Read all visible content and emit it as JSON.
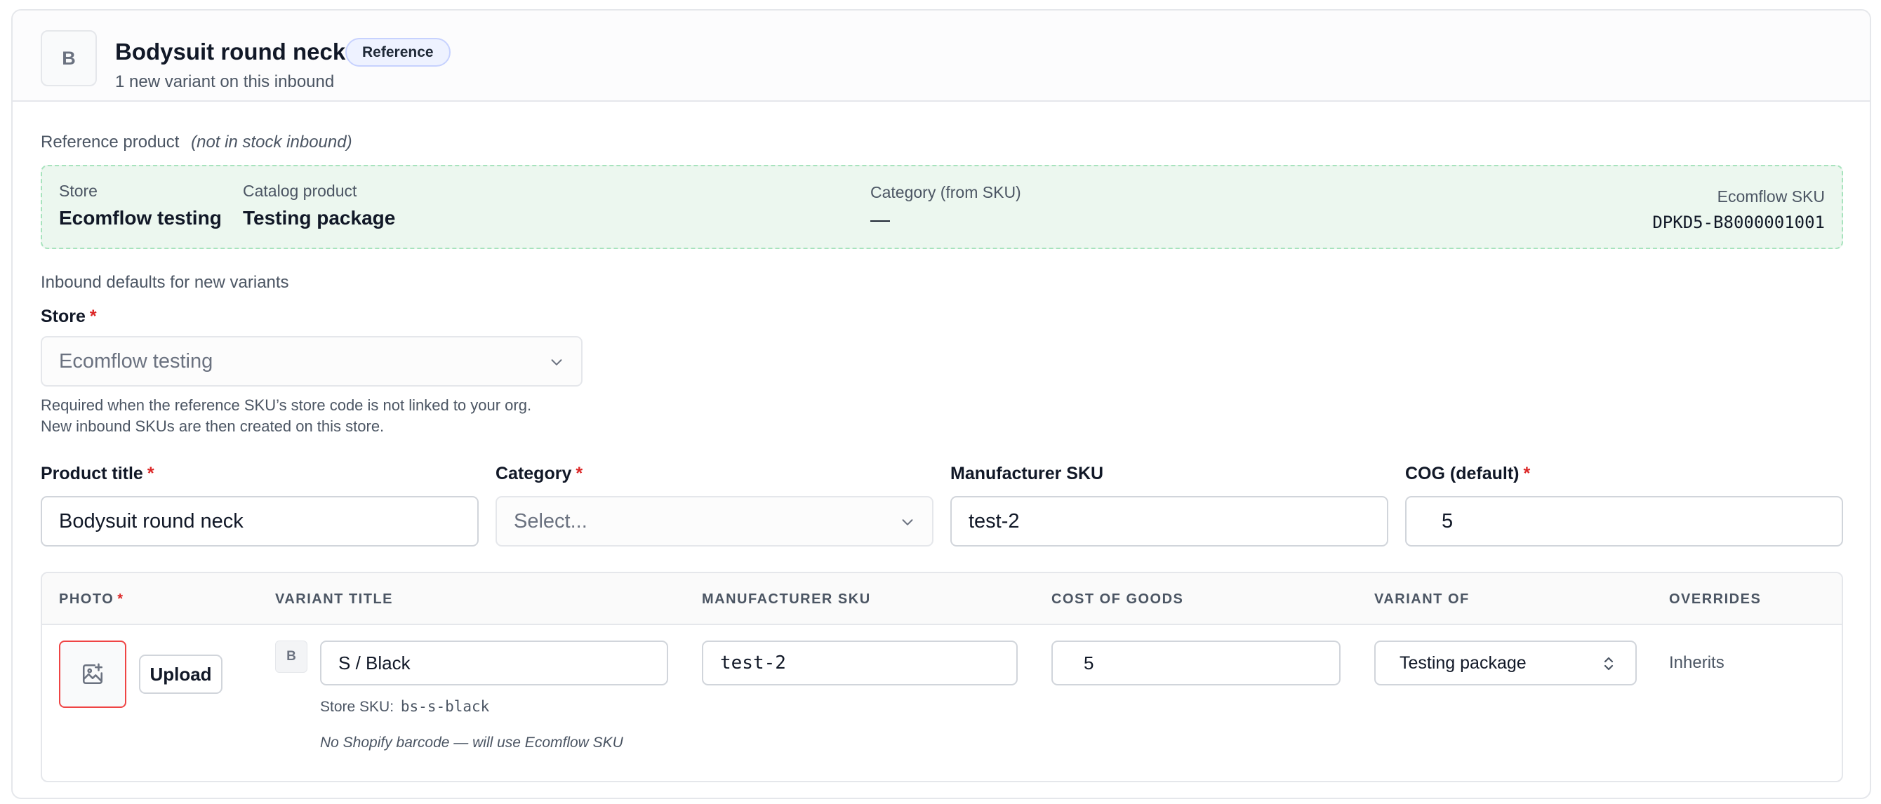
{
  "header": {
    "avatar_letter": "B",
    "product_name": "Bodysuit round neck",
    "badge": "Reference",
    "subtitle": "1 new variant on this inbound"
  },
  "reference": {
    "label": "Reference product",
    "note": "(not in stock inbound)",
    "store_key": "Store",
    "store_value": "Ecomflow testing",
    "catalog_key": "Catalog product",
    "catalog_value": "Testing package",
    "category_key": "Category (from SKU)",
    "category_value": "—",
    "sku_key": "Ecomflow SKU",
    "sku_value": "DPKD5-B8000001001"
  },
  "defaults": {
    "section_label": "Inbound defaults for new variants",
    "store_label": "Store",
    "required_mark": "*",
    "store_value": "Ecomflow testing",
    "help_line_1": "Required when the reference SKU’s store code is not linked to your org.",
    "help_line_2": "New inbound SKUs are then created on this store."
  },
  "fields": {
    "product_title_label": "Product title",
    "product_title_value": "Bodysuit round neck",
    "category_label": "Category",
    "category_placeholder": "Select...",
    "manufacturer_sku_label": "Manufacturer SKU",
    "manufacturer_sku_value": "test-2",
    "cog_label": "COG (default)",
    "cog_value": "5"
  },
  "table": {
    "headers": {
      "photo": "PHOTO",
      "variant_title": "VARIANT TITLE",
      "manufacturer_sku": "MANUFACTURER SKU",
      "cost_of_goods": "COST OF GOODS",
      "variant_of": "VARIANT OF",
      "overrides": "OVERRIDES"
    },
    "rows": [
      {
        "upload_label": "Upload",
        "avatar_letter": "B",
        "variant_title": "S / Black",
        "store_sku_label": "Store SKU:",
        "store_sku_value": "bs-s-black",
        "barcode_note": "No Shopify barcode — will use Ecomflow SKU",
        "manufacturer_sku": "test-2",
        "cost_of_goods": "5",
        "variant_of": "Testing package",
        "overrides": "Inherits"
      }
    ]
  },
  "icons": {
    "photo_placeholder": "image-plus-icon",
    "dropdown": "chevron-down-icon",
    "select_updown": "chevron-up-down-icon"
  },
  "colors": {
    "reference_panel_bg": "#ecf7ef",
    "reference_panel_border": "#a7e3bd",
    "required": "#dc2626",
    "photo_error_border": "#ef4444"
  }
}
